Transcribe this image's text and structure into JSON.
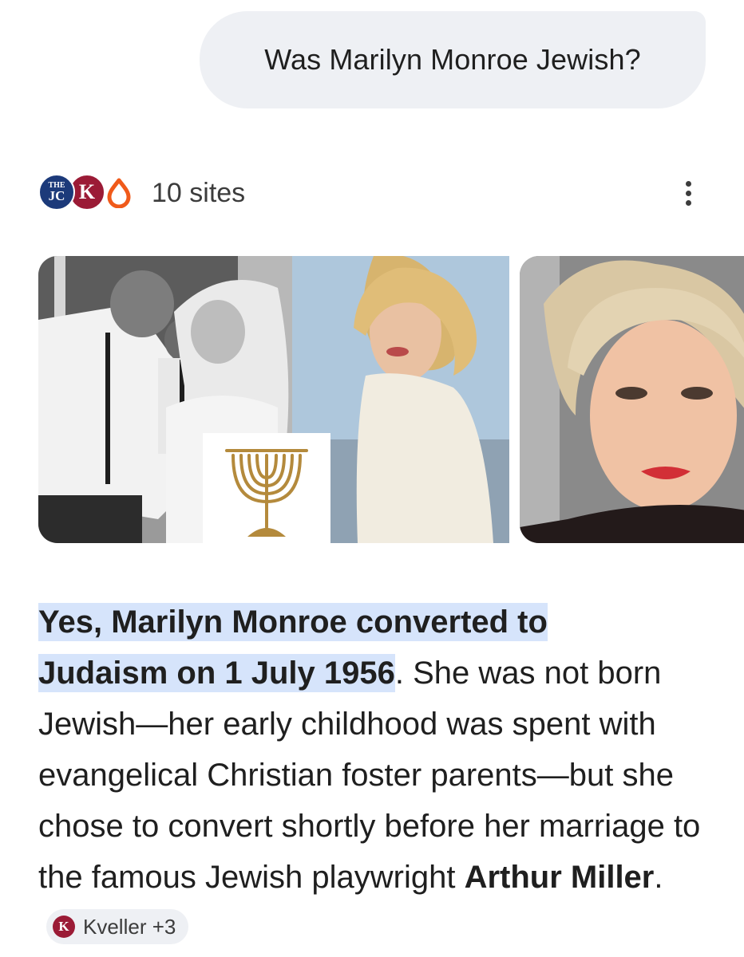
{
  "query": {
    "text": "Was Marilyn Monroe Jewish?"
  },
  "sources": {
    "count_label": "10 sites",
    "favicons": [
      {
        "name": "the-jc-favicon",
        "line1": "THE",
        "line2": "JC"
      },
      {
        "name": "kveller-favicon",
        "letter": "K"
      },
      {
        "name": "orange-drop-favicon"
      }
    ],
    "more_icon": "more-vert-icon"
  },
  "images": [
    {
      "name": "wedding-menorah-collage-image"
    },
    {
      "name": "portrait-image"
    }
  ],
  "answer": {
    "highlight_1": "Yes, Marilyn Monroe converted to",
    "highlight_2": "Judaism on 1 July 1956",
    "text_1": ". She was not born Jewish—her early childhood was spent with evangelical Christian foster parents—but she chose to convert shortly before her marriage to the famous Jewish playwright ",
    "bold_name": "Arthur Miller",
    "text_2": ".",
    "citation": {
      "icon_letter": "K",
      "label": "Kveller +3"
    }
  },
  "colors": {
    "highlight": "#d6e4fb",
    "bubble": "#eef0f4",
    "kveller_brand": "#9b1b36",
    "jc_brand": "#1c3a7a"
  }
}
